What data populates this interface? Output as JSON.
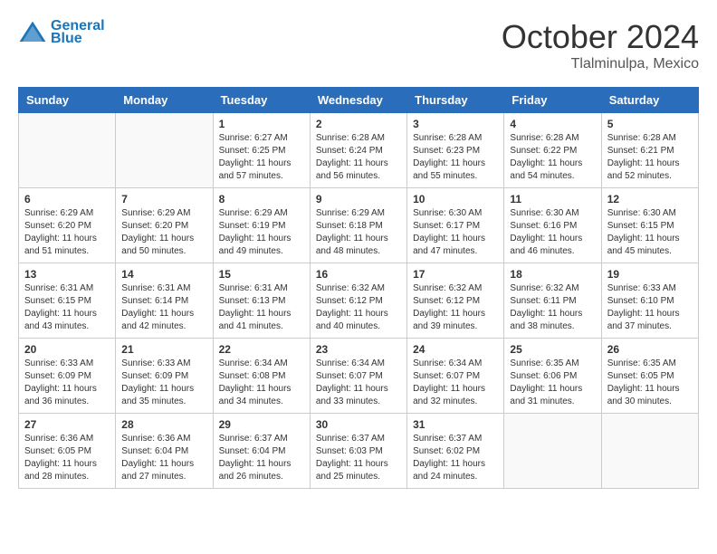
{
  "header": {
    "logo_line1": "General",
    "logo_line2": "Blue",
    "month": "October 2024",
    "location": "Tlalminulpa, Mexico"
  },
  "weekdays": [
    "Sunday",
    "Monday",
    "Tuesday",
    "Wednesday",
    "Thursday",
    "Friday",
    "Saturday"
  ],
  "weeks": [
    [
      {
        "day": "",
        "info": ""
      },
      {
        "day": "",
        "info": ""
      },
      {
        "day": "1",
        "info": "Sunrise: 6:27 AM\nSunset: 6:25 PM\nDaylight: 11 hours and 57 minutes."
      },
      {
        "day": "2",
        "info": "Sunrise: 6:28 AM\nSunset: 6:24 PM\nDaylight: 11 hours and 56 minutes."
      },
      {
        "day": "3",
        "info": "Sunrise: 6:28 AM\nSunset: 6:23 PM\nDaylight: 11 hours and 55 minutes."
      },
      {
        "day": "4",
        "info": "Sunrise: 6:28 AM\nSunset: 6:22 PM\nDaylight: 11 hours and 54 minutes."
      },
      {
        "day": "5",
        "info": "Sunrise: 6:28 AM\nSunset: 6:21 PM\nDaylight: 11 hours and 52 minutes."
      }
    ],
    [
      {
        "day": "6",
        "info": "Sunrise: 6:29 AM\nSunset: 6:20 PM\nDaylight: 11 hours and 51 minutes."
      },
      {
        "day": "7",
        "info": "Sunrise: 6:29 AM\nSunset: 6:20 PM\nDaylight: 11 hours and 50 minutes."
      },
      {
        "day": "8",
        "info": "Sunrise: 6:29 AM\nSunset: 6:19 PM\nDaylight: 11 hours and 49 minutes."
      },
      {
        "day": "9",
        "info": "Sunrise: 6:29 AM\nSunset: 6:18 PM\nDaylight: 11 hours and 48 minutes."
      },
      {
        "day": "10",
        "info": "Sunrise: 6:30 AM\nSunset: 6:17 PM\nDaylight: 11 hours and 47 minutes."
      },
      {
        "day": "11",
        "info": "Sunrise: 6:30 AM\nSunset: 6:16 PM\nDaylight: 11 hours and 46 minutes."
      },
      {
        "day": "12",
        "info": "Sunrise: 6:30 AM\nSunset: 6:15 PM\nDaylight: 11 hours and 45 minutes."
      }
    ],
    [
      {
        "day": "13",
        "info": "Sunrise: 6:31 AM\nSunset: 6:15 PM\nDaylight: 11 hours and 43 minutes."
      },
      {
        "day": "14",
        "info": "Sunrise: 6:31 AM\nSunset: 6:14 PM\nDaylight: 11 hours and 42 minutes."
      },
      {
        "day": "15",
        "info": "Sunrise: 6:31 AM\nSunset: 6:13 PM\nDaylight: 11 hours and 41 minutes."
      },
      {
        "day": "16",
        "info": "Sunrise: 6:32 AM\nSunset: 6:12 PM\nDaylight: 11 hours and 40 minutes."
      },
      {
        "day": "17",
        "info": "Sunrise: 6:32 AM\nSunset: 6:12 PM\nDaylight: 11 hours and 39 minutes."
      },
      {
        "day": "18",
        "info": "Sunrise: 6:32 AM\nSunset: 6:11 PM\nDaylight: 11 hours and 38 minutes."
      },
      {
        "day": "19",
        "info": "Sunrise: 6:33 AM\nSunset: 6:10 PM\nDaylight: 11 hours and 37 minutes."
      }
    ],
    [
      {
        "day": "20",
        "info": "Sunrise: 6:33 AM\nSunset: 6:09 PM\nDaylight: 11 hours and 36 minutes."
      },
      {
        "day": "21",
        "info": "Sunrise: 6:33 AM\nSunset: 6:09 PM\nDaylight: 11 hours and 35 minutes."
      },
      {
        "day": "22",
        "info": "Sunrise: 6:34 AM\nSunset: 6:08 PM\nDaylight: 11 hours and 34 minutes."
      },
      {
        "day": "23",
        "info": "Sunrise: 6:34 AM\nSunset: 6:07 PM\nDaylight: 11 hours and 33 minutes."
      },
      {
        "day": "24",
        "info": "Sunrise: 6:34 AM\nSunset: 6:07 PM\nDaylight: 11 hours and 32 minutes."
      },
      {
        "day": "25",
        "info": "Sunrise: 6:35 AM\nSunset: 6:06 PM\nDaylight: 11 hours and 31 minutes."
      },
      {
        "day": "26",
        "info": "Sunrise: 6:35 AM\nSunset: 6:05 PM\nDaylight: 11 hours and 30 minutes."
      }
    ],
    [
      {
        "day": "27",
        "info": "Sunrise: 6:36 AM\nSunset: 6:05 PM\nDaylight: 11 hours and 28 minutes."
      },
      {
        "day": "28",
        "info": "Sunrise: 6:36 AM\nSunset: 6:04 PM\nDaylight: 11 hours and 27 minutes."
      },
      {
        "day": "29",
        "info": "Sunrise: 6:37 AM\nSunset: 6:04 PM\nDaylight: 11 hours and 26 minutes."
      },
      {
        "day": "30",
        "info": "Sunrise: 6:37 AM\nSunset: 6:03 PM\nDaylight: 11 hours and 25 minutes."
      },
      {
        "day": "31",
        "info": "Sunrise: 6:37 AM\nSunset: 6:02 PM\nDaylight: 11 hours and 24 minutes."
      },
      {
        "day": "",
        "info": ""
      },
      {
        "day": "",
        "info": ""
      }
    ]
  ]
}
